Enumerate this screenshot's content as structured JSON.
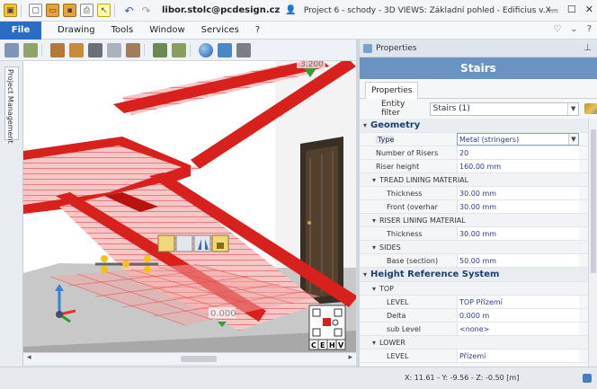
{
  "titlebar": {
    "user": "libor.stolc@pcdesign.cz",
    "title": "Project 6 - schody - 3D VIEWS: Základní pohled - Edificius v.X..."
  },
  "menubar": {
    "file": "File",
    "items": [
      "Drawing",
      "Tools",
      "Window",
      "Services",
      "?"
    ]
  },
  "left_panel": {
    "tab_label": "Project Management"
  },
  "viewport": {
    "top_annotation": "3.200",
    "dim_value": "0.000",
    "view_cube_letters": [
      "C",
      "E",
      "H",
      "V"
    ],
    "colors": {
      "stair": "#d8201c",
      "floor": "#b9b9b9",
      "door": "#3a2f27"
    }
  },
  "properties": {
    "panel_title": "Properties",
    "object_title": "Stairs",
    "tab_label": "Properties",
    "entity_filter_label": "Entity filter",
    "entity_filter_value": "Stairs (1)",
    "rows": [
      {
        "kind": "cat",
        "label": "Geometry"
      },
      {
        "kind": "prop",
        "label": "Type",
        "value": "Metal (stringers)",
        "dropdown": true
      },
      {
        "kind": "prop",
        "label": "Number of Risers",
        "value": "20"
      },
      {
        "kind": "prop",
        "label": "Riser height",
        "value": "160.00 mm"
      },
      {
        "kind": "sub",
        "label": "TREAD LINING MATERIAL"
      },
      {
        "kind": "prop2",
        "label": "Thickness",
        "value": "30.00 mm"
      },
      {
        "kind": "prop2",
        "label": "Front (overhar",
        "value": "30.00 mm"
      },
      {
        "kind": "sub",
        "label": "RISER LINING MATERIAL"
      },
      {
        "kind": "prop2",
        "label": "Thickness",
        "value": "30.00 mm"
      },
      {
        "kind": "sub",
        "label": "SIDES"
      },
      {
        "kind": "prop2",
        "label": "Base (section)",
        "value": "50.00 mm"
      },
      {
        "kind": "cat",
        "label": "Height Reference System"
      },
      {
        "kind": "sub",
        "label": "TOP"
      },
      {
        "kind": "prop2",
        "label": "LEVEL",
        "value": "TOP Přízemí"
      },
      {
        "kind": "prop2",
        "label": "Delta",
        "value": "0.000 m"
      },
      {
        "kind": "prop2",
        "label": "sub Level",
        "value": "<none>"
      },
      {
        "kind": "sub",
        "label": "LOWER"
      },
      {
        "kind": "prop2",
        "label": "LEVEL",
        "value": "Přízemí"
      }
    ]
  },
  "statusbar": {
    "coords": "X: 11.61 - Y: -9.56 - Z: -0.50 [m]"
  }
}
